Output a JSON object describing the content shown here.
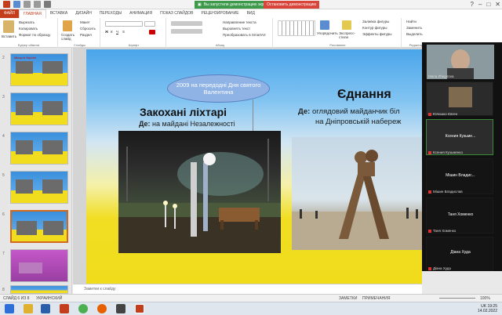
{
  "window": {
    "share_banner": "Вы запустили демонстрацию экрана",
    "stop_share": "Остановить демонстрацию",
    "controls": [
      "?",
      "–",
      "□",
      "✕"
    ]
  },
  "ribbon_tabs": [
    "ФАЙЛ",
    "ГЛАВНАЯ",
    "ВСТАВКА",
    "ДИЗАЙН",
    "ПЕРЕХОДЫ",
    "АНИМАЦИЯ",
    "ПОКАЗ СЛАЙДОВ",
    "РЕЦЕНЗИРОВАНИЕ",
    "ВИД"
  ],
  "ribbon": {
    "insert_label": "Вставить",
    "cut": "Вырезать",
    "copy": "Копировать",
    "format_painter": "Формат по образцу",
    "clipboard": "Буфер обмена",
    "new_slide": "Создать слайд",
    "layout": "Макет",
    "reset": "Сбросить",
    "section": "Раздел",
    "slides": "Слайды",
    "font": "Шрифт",
    "paragraph": "Абзац",
    "text_dir": "Направление текста",
    "align_text": "Выровнять текст",
    "smartart": "Преобразовать в SmartArt",
    "arrange": "Упорядочить",
    "quick_styles": "Экспресс-стили",
    "drawing": "Рисование",
    "fill": "Заливка фигуры",
    "outline": "Контур фигуры",
    "effects": "Эффекты фигуры",
    "find": "Найти",
    "replace": "Заменить",
    "select": "Выделить",
    "editing": "Редактирование"
  },
  "thumbnails": [
    {
      "num": "2",
      "style": "tyb",
      "title": "Місця в Україні"
    },
    {
      "num": "3",
      "style": "tyb",
      "title": ""
    },
    {
      "num": "4",
      "style": "tyb",
      "title": ""
    },
    {
      "num": "5",
      "style": "tyb",
      "title": ""
    },
    {
      "num": "6",
      "style": "tyb",
      "title": ""
    },
    {
      "num": "7",
      "style": "tpurple",
      "title": ""
    },
    {
      "num": "8",
      "style": "tyb",
      "title": ""
    }
  ],
  "slide": {
    "oval_text": "2009 на передодні Дня святого Валентина",
    "title_left": "Закохані ліхтарі",
    "where_label": "Де:",
    "where_left": "на майдані Незалежності",
    "title_right": "Єднання",
    "where_right_1": "оглядовий майданчик біл",
    "where_right_2": "на Дніпровській набереж"
  },
  "notes_placeholder": "Заметки к слайду",
  "participants": [
    {
      "name": "",
      "sub": "Maria Zhegirova",
      "kind": "camera"
    },
    {
      "name": "",
      "sub": "Юлошко Євген",
      "kind": "photo"
    },
    {
      "name": "Ксения Кузьме...",
      "sub": "Ксения Кузьменко",
      "kind": "text"
    },
    {
      "name": "Мішин Владис...",
      "sub": "Мішин Владислав",
      "kind": "text"
    },
    {
      "name": "Таня Хоменко",
      "sub": "Таня Хоменко",
      "kind": "text"
    },
    {
      "name": "Діана Худа",
      "sub": "Діана Худа",
      "kind": "text"
    }
  ],
  "statusbar": {
    "slide_info": "СЛАЙД 6 ИЗ 8",
    "language": "УКРАИНСКИЙ",
    "notes": "ЗАМЕТКИ",
    "comments": "ПРИМЕЧАНИЯ",
    "zoom": "100%"
  },
  "tray": {
    "lang": "UK",
    "time": "19:25",
    "date": "14.02.2022"
  },
  "colors": {
    "accent": "#c43e1c",
    "slide_blue": "#4aa5ea",
    "slide_yellow": "#f0dc1a",
    "oval": "#8fb3e4"
  }
}
